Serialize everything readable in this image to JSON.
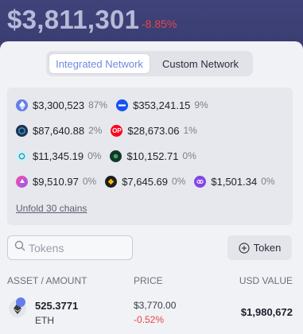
{
  "header": {
    "balance": "$3,811,301",
    "change": "-8.85%"
  },
  "network_toggle": {
    "options": [
      "Integrated Network",
      "Custom Network"
    ],
    "active": "Integrated Network"
  },
  "chains": {
    "rows": [
      [
        {
          "icon": "ethereum-icon",
          "color": "#627eea",
          "amount": "$3,300,523",
          "pct": "87%"
        },
        {
          "icon": "base-chain-icon",
          "color": "#1652f0",
          "amount": "$353,241.15",
          "pct": "9%"
        }
      ],
      [
        {
          "icon": "arbitrum-icon",
          "color": "#213147",
          "amount": "$87,640.88",
          "pct": "2%"
        },
        {
          "icon": "optimism-icon",
          "color": "#ff0420",
          "amount": "$28,673.06",
          "pct": "1%"
        }
      ],
      [
        {
          "icon": "linea-icon",
          "color": "#61dfff",
          "amount": "$11,345.19",
          "pct": "0%"
        },
        {
          "icon": "gnosis-icon",
          "color": "#133629",
          "amount": "$10,152.71",
          "pct": "0%"
        }
      ],
      [
        {
          "icon": "blast-icon",
          "color": "#e84142",
          "amount": "$9,510.97",
          "pct": "0%"
        },
        {
          "icon": "bnb-icon",
          "color": "#f0b90b",
          "amount": "$7,645.69",
          "pct": "0%"
        },
        {
          "icon": "polygon-icon",
          "color": "#8247e5",
          "amount": "$1,501.34",
          "pct": "0%"
        }
      ]
    ],
    "unfold_label": "Unfold 30 chains"
  },
  "search": {
    "placeholder": "Tokens"
  },
  "add_token": {
    "label": "Token"
  },
  "table": {
    "headers": [
      "ASSET / AMOUNT",
      "PRICE",
      "USD VALUE"
    ],
    "rows": [
      {
        "icon": "ethereum-icon",
        "amount": "525.3771",
        "symbol": "ETH",
        "price": "$3,770.00",
        "price_change": "-0.52%",
        "usd_value": "$1,980,672"
      }
    ]
  },
  "colors": {
    "accent": "#6e8ae0",
    "negative": "#e8444a",
    "header_bg": "#3b3f6e"
  }
}
